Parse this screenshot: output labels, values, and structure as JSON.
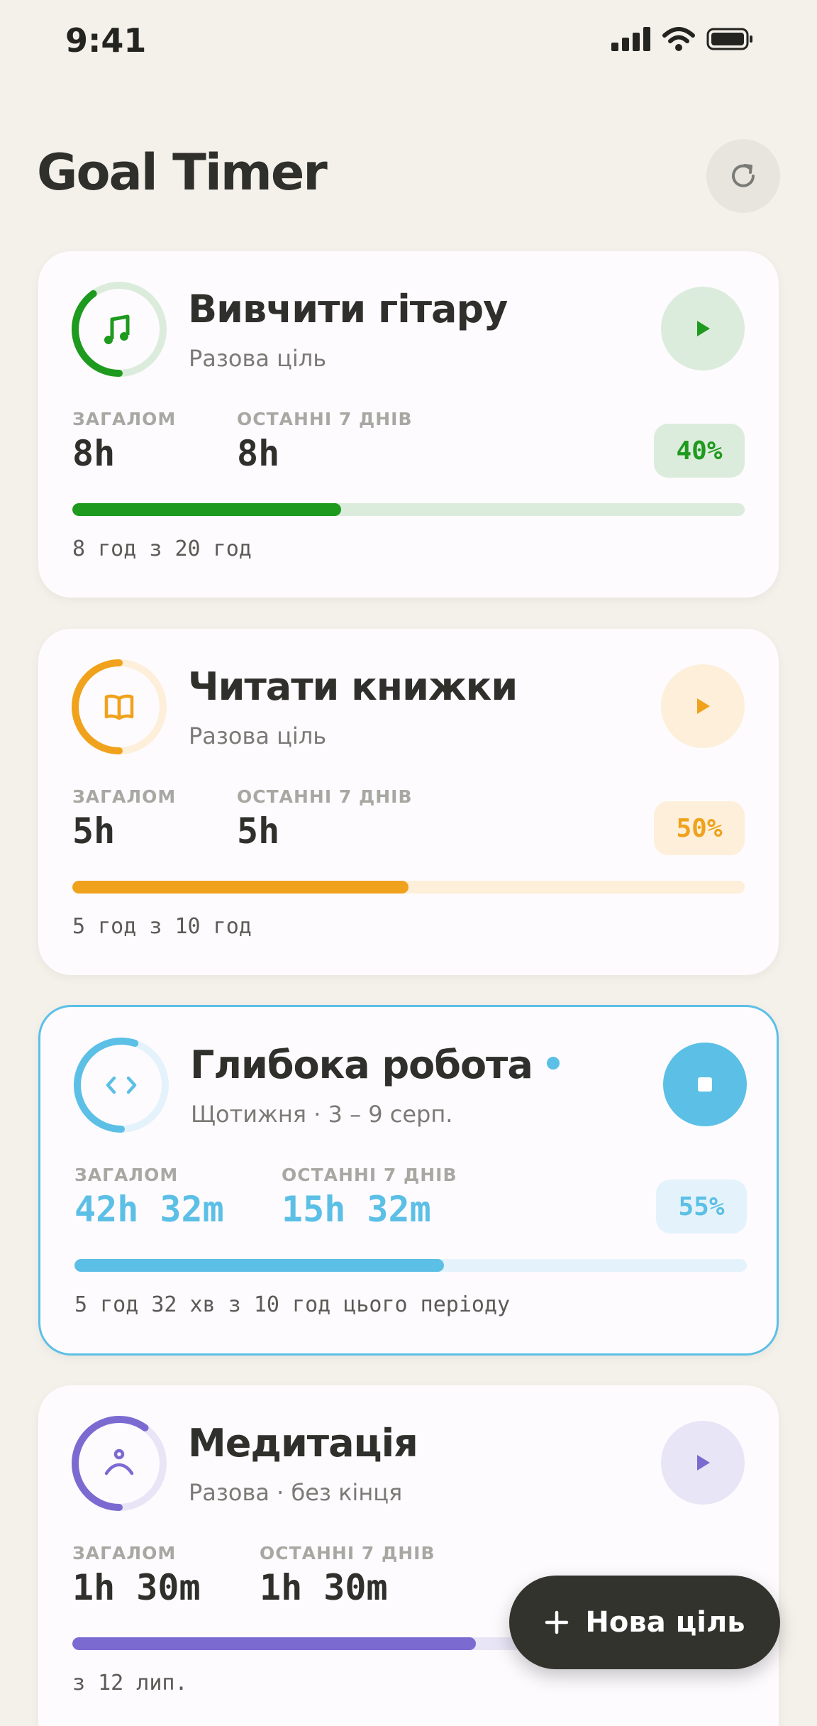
{
  "status_bar": {
    "time": "9:41"
  },
  "header": {
    "title": "Goal Timer"
  },
  "goals": [
    {
      "title": "Вивчити гітару",
      "subtitle": "Разова ціль",
      "icon": "music-note-icon",
      "accent": "#1e9a1e",
      "tint": "#dcecdc",
      "button": "play",
      "total_label": "ЗАГАЛОМ",
      "total_value": "8h",
      "week_label": "ОСТАННІ 7 ДНІВ",
      "week_value": "8h",
      "percent": "40%",
      "progress": 0.4,
      "footer": "8 год з 20 год",
      "active": false
    },
    {
      "title": "Читати книжки",
      "subtitle": "Разова ціль",
      "icon": "book-icon",
      "accent": "#f0a21c",
      "tint": "#fdefd9",
      "button": "play",
      "total_label": "ЗАГАЛОМ",
      "total_value": "5h",
      "week_label": "ОСТАННІ 7 ДНІВ",
      "week_value": "5h",
      "percent": "50%",
      "progress": 0.5,
      "footer": "5 год з 10 год",
      "active": false
    },
    {
      "title": "Глибока робота",
      "subtitle": "Щотижня · 3 – 9 серп.",
      "icon": "code-icon",
      "accent": "#5cbfe6",
      "tint": "#e4f3fb",
      "button": "stop",
      "total_label": "ЗАГАЛОМ",
      "total_value": "42h 32m",
      "week_label": "ОСТАННІ 7 ДНІВ",
      "week_value": "15h 32m",
      "percent": "55%",
      "progress": 0.55,
      "footer": "5 год 32 хв з 10 год цього періоду",
      "active": true
    },
    {
      "title": "Медитація",
      "subtitle": "Разова · без кінця",
      "icon": "meditation-icon",
      "accent": "#7b6bd1",
      "tint": "#e8e5f6",
      "button": "play",
      "total_label": "ЗАГАЛОМ",
      "total_value": "1h 30m",
      "week_label": "ОСТАННІ 7 ДНІВ",
      "week_value": "1h 30m",
      "percent": "",
      "progress": 0.6,
      "footer": "з 12 лип.",
      "active": false
    }
  ],
  "fab": {
    "label": "Нова ціль",
    "icon": "plus-icon"
  }
}
